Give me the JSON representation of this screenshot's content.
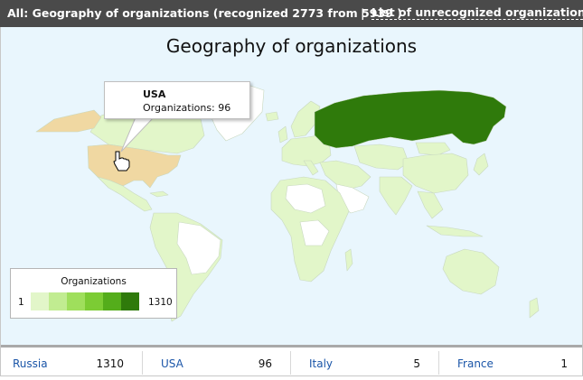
{
  "header": {
    "title": "All: Geography of organizations (recognized 2773 from 5939 )",
    "separator": "|",
    "unrecognized_link": "List of unrecognized organizations"
  },
  "map": {
    "title": "Geography of organizations",
    "hovered_country": "USA",
    "colors": {
      "ocean": "#e9f6fd",
      "no_data": "#ffffff",
      "border": "#c8d8c0",
      "highlight": "#f0d8a2",
      "russia": "#2f7a0b"
    }
  },
  "tooltip": {
    "country": "USA",
    "value_text": "Organizations: 96"
  },
  "legend": {
    "title": "Organizations",
    "min": "1",
    "max": "1310",
    "swatches": [
      "#e2f6c9",
      "#c1ec91",
      "#9fdf5c",
      "#7ccc34",
      "#54ad1b",
      "#2f7a0b"
    ]
  },
  "country_list": [
    {
      "name": "Russia",
      "value": "1310"
    },
    {
      "name": "USA",
      "value": "96"
    },
    {
      "name": "Italy",
      "value": "5"
    },
    {
      "name": "France",
      "value": "1"
    }
  ]
}
